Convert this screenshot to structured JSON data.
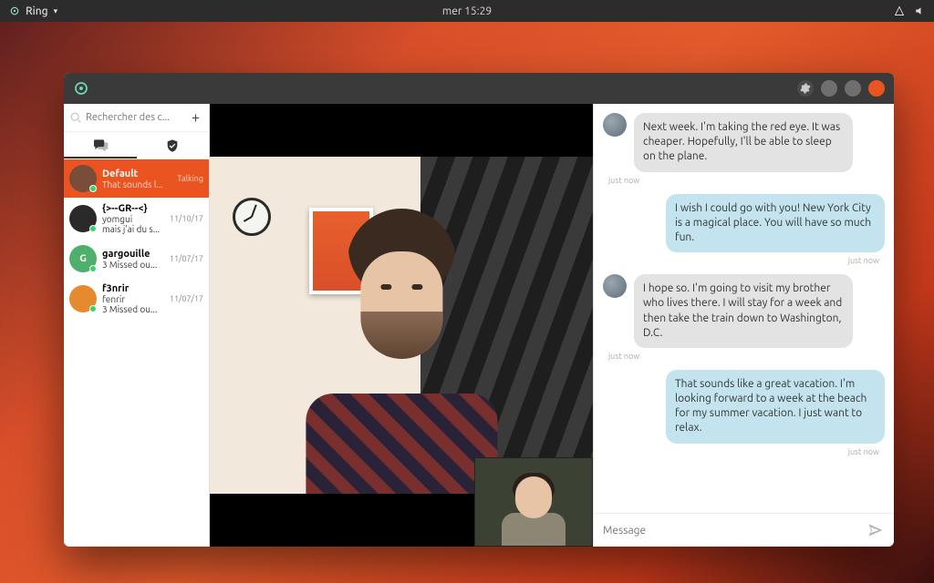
{
  "topbar": {
    "app_label": "Ring",
    "clock": "mer 15:29"
  },
  "titlebar": {
    "gear_label": "Settings"
  },
  "sidebar": {
    "search_placeholder": "Rechercher des c...",
    "tabs": {
      "chats": "Chats",
      "trusted": "Trusted"
    },
    "contacts": [
      {
        "name": "Default",
        "sub": "That sounds l...",
        "date": "",
        "talking": "Talking",
        "avatar_color": "#7a4c3a"
      },
      {
        "name": "{>--GR--<}",
        "sub": "yomgui\nmais j'ai du s...",
        "date": "11/10/17",
        "avatar_color": "#2a2a2a"
      },
      {
        "name": "gargouille",
        "sub": "3 Missed ou...",
        "date": "11/07/17",
        "avatar_color": "#4fb06d",
        "initial": "G"
      },
      {
        "name": "f3nrir",
        "sub": "fenrir\n3 Missed ou...",
        "date": "11/07/17",
        "avatar_color": "#e58a2e"
      }
    ]
  },
  "chat": {
    "messages": [
      {
        "dir": "in",
        "text": "Next week. I'm taking the red  eye. It was cheaper. Hopefully, I'll be able to sleep on the plane.",
        "ts": "just now"
      },
      {
        "dir": "out",
        "text": "I wish I could go with you! New York City is a magical place. You will have so much fun.",
        "ts": "just now"
      },
      {
        "dir": "in",
        "text": "I hope so. I'm going to visit my brother who lives there. I will stay for a week and then take the train down to Washington, D.C.",
        "ts": "just now"
      },
      {
        "dir": "out",
        "text": "That sounds like a great vacation. I'm looking forward to a week at the beach for my summer vacation. I just want to relax.",
        "ts": "just now"
      }
    ],
    "composer_placeholder": "Message"
  }
}
